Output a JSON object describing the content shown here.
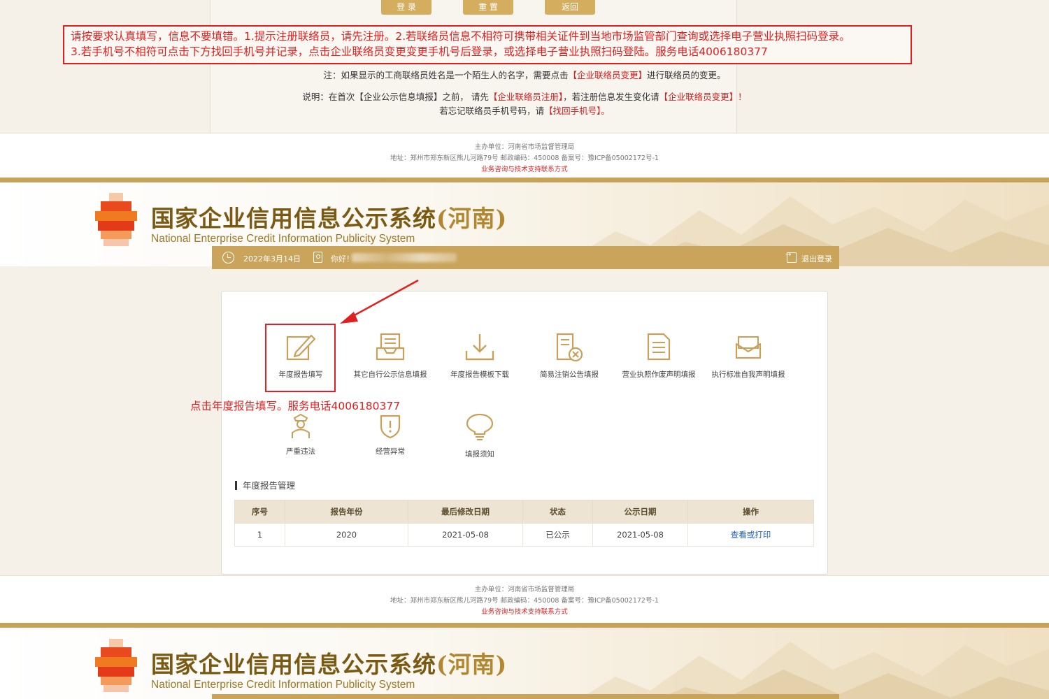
{
  "top_section": {
    "buttons": [
      "登 录",
      "重 置",
      "返回"
    ],
    "warning_line1": "请按要求认真填写，信息不要填错。1.提示注册联络员，请先注册。2.若联络员信息不相符可携带相关证件到当地市场监管部门查询或选择电子营业执照扫码登录。",
    "warning_line2": "3.若手机号不相符可点击下方找回手机号并记录，点击企业联络员变更变更手机号后登录，或选择电子营业执照扫码登陆。服务电话4006180377",
    "note": {
      "prefix": "注：如果显示的工商联络员姓名是一个陌生人的名字，需要点击",
      "link": "【企业联络员变更】",
      "suffix": "进行联络员的变更。"
    },
    "explain": {
      "part1": "说明：在首次【企业公示信息填报】之前， 请先",
      "link1": "【企业联络员注册】",
      "part2": "，若注册信息发生变化请",
      "link2": "【企业联络员变更】！"
    },
    "forgot": {
      "prefix": "若忘记联络员手机号码，请",
      "link": "【找回手机号】。"
    }
  },
  "footer": {
    "host": "主办单位：河南省市场监督管理局",
    "address": "地址：郑州市郑东新区熊儿河路79号 邮政编码：450008 备案号：豫ICP备05002172号-1",
    "contact": "业务咨询与技术支持联系方式"
  },
  "header": {
    "title_main": "国家企业信用信息公示系统",
    "title_region": "(河南)",
    "title_en": "National Enterprise Credit Information Publicity System",
    "date": "2022年3月14日",
    "greeting": "你好！",
    "logout": "退出登录"
  },
  "functions": [
    {
      "label": "年度报告填写",
      "icon": "edit-icon"
    },
    {
      "label": "其它自行公示信息填报",
      "icon": "inbox-icon"
    },
    {
      "label": "年度报告模板下载",
      "icon": "download-icon"
    },
    {
      "label": "简易注销公告填报",
      "icon": "cancel-doc-icon"
    },
    {
      "label": "营业执照作废声明填报",
      "icon": "document-icon"
    },
    {
      "label": "执行标准自我声明填报",
      "icon": "envelope-icon"
    },
    {
      "label": "严重违法",
      "icon": "officer-icon"
    },
    {
      "label": "经营异常",
      "icon": "shield-icon"
    },
    {
      "label": "填报须知",
      "icon": "lightbulb-icon"
    }
  ],
  "hint": "点击年度报告填写。服务电话4006180377",
  "report_section": {
    "title": "年度报告管理",
    "columns": [
      "序号",
      "报告年份",
      "最后修改日期",
      "状态",
      "公示日期",
      "操作"
    ],
    "rows": [
      {
        "index": "1",
        "year": "2020",
        "modified": "2021-05-08",
        "status": "已公示",
        "published": "2021-05-08",
        "action": "查看或打印"
      }
    ]
  },
  "colors": {
    "gold": "#c9a45a",
    "brand_brown": "#7a5a12",
    "alert_red": "#e02020",
    "link_blue": "#1c5cb8"
  }
}
